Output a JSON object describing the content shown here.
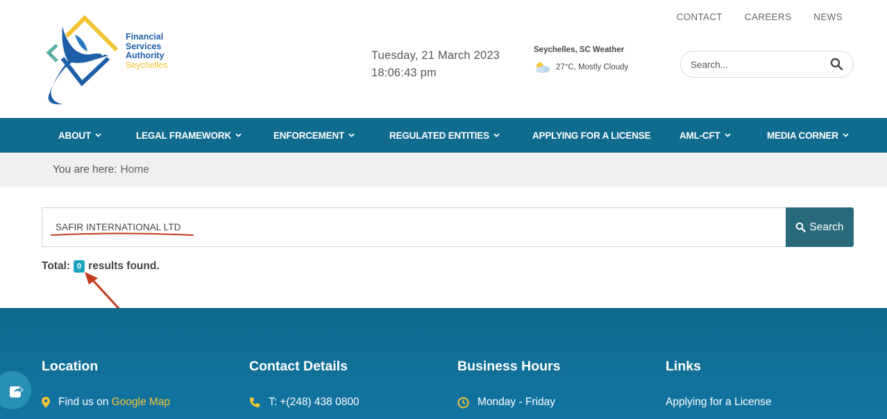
{
  "logo": {
    "lines": [
      "Financial",
      "Services",
      "Authority",
      "Seychelles"
    ],
    "colors": {
      "blue": "#1f5fa8",
      "gold": "#f2c230",
      "teal": "#5aaea4"
    }
  },
  "top_links": [
    "CONTACT",
    "CAREERS",
    "NEWS"
  ],
  "datetime": {
    "date": "Tuesday, 21 March 2023",
    "time": "18:06:43 pm"
  },
  "weather": {
    "title": "Seychelles, SC Weather",
    "summary": "27°C, Mostly Cloudy",
    "icon": "cloudy-weather-icon"
  },
  "header_search": {
    "placeholder": "Search...",
    "icon": "magnifier-icon"
  },
  "nav": [
    {
      "label": "ABOUT",
      "dropdown": true
    },
    {
      "label": "LEGAL FRAMEWORK",
      "dropdown": true
    },
    {
      "label": "ENFORCEMENT",
      "dropdown": true
    },
    {
      "label": "REGULATED ENTITIES",
      "dropdown": true
    },
    {
      "label": "APPLYING FOR A LICENSE",
      "dropdown": false
    },
    {
      "label": "AML-CFT",
      "dropdown": true
    },
    {
      "label": "MEDIA CORNER",
      "dropdown": true
    }
  ],
  "breadcrumb": {
    "prefix": "You are here:",
    "home": "Home"
  },
  "search": {
    "value": "SAFIR INTERNATIONAL LTD",
    "button_label": "Search"
  },
  "results": {
    "prefix": "Total:",
    "count": "0",
    "suffix": "results found."
  },
  "footer": {
    "location": {
      "heading": "Location",
      "text": "Find us on",
      "link": "Google Map"
    },
    "contact": {
      "heading": "Contact Details",
      "phone": "T: +(248) 438 0800"
    },
    "hours": {
      "heading": "Business Hours",
      "days": "Monday - Friday"
    },
    "links": {
      "heading": "Links",
      "first": "Applying for a License"
    }
  },
  "colors": {
    "nav_bg": "#106c8f",
    "search_btn": "#286a7b",
    "badge": "#1ea4be",
    "gold": "#f4c534",
    "annotation": "#c0391b"
  }
}
